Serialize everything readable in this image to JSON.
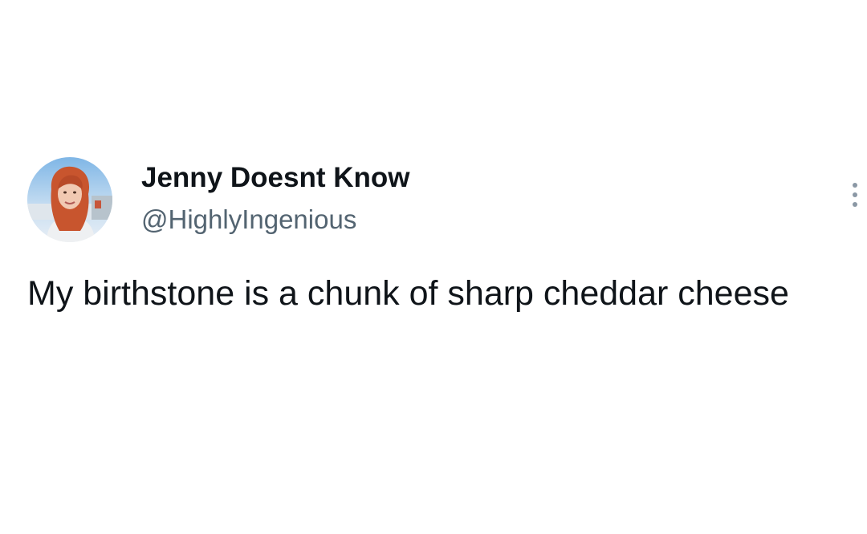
{
  "tweet": {
    "author": {
      "display_name": "Jenny Doesnt Know",
      "handle": "@HighlyIngenious",
      "avatar_icon": "profile-photo"
    },
    "text": "My birthstone is a chunk of sharp cheddar cheese",
    "more_icon": "more-vertical-icon"
  },
  "colors": {
    "background": "#ffffff",
    "primary_text": "#0f1419",
    "secondary_text": "#536471"
  }
}
